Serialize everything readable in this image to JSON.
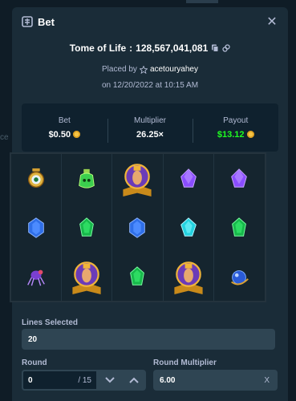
{
  "modal": {
    "title": "Bet",
    "game_name": "Tome of Life",
    "bet_id": "128,567,041,081",
    "placed_by_prefix": "Placed by",
    "username": "acetouryahey",
    "date_line": "on 12/20/2022 at 10:15 AM"
  },
  "stats": {
    "bet_label": "Bet",
    "bet_value": "$0.50",
    "multiplier_label": "Multiplier",
    "multiplier_value": "26.25×",
    "payout_label": "Payout",
    "payout_value": "$13.12"
  },
  "reels": [
    [
      "clock-eye-icon",
      "green-potion-icon",
      "pharaoh-book-icon",
      "purple-gem-icon",
      "purple-gem-icon"
    ],
    [
      "blue-gem-icon",
      "green-gem-icon",
      "blue-gem-icon",
      "cyan-gem-icon",
      "green-gem-icon"
    ],
    [
      "purple-spider-icon",
      "pharaoh-book-icon",
      "green-gem-icon",
      "pharaoh-book-icon",
      "blue-orb-icon"
    ]
  ],
  "controls": {
    "lines_label": "Lines Selected",
    "lines_value": "20",
    "round_label": "Round",
    "round_value": "0",
    "round_total": "/ 15",
    "round_multiplier_label": "Round Multiplier",
    "round_multiplier_value": "6.00",
    "round_multiplier_suffix": "X"
  },
  "colors": {
    "background": "#0f1c26",
    "modal": "#1a2c38",
    "payout_green": "#1fff20",
    "coin_gold": "#f6c444"
  },
  "background_text": "ce"
}
